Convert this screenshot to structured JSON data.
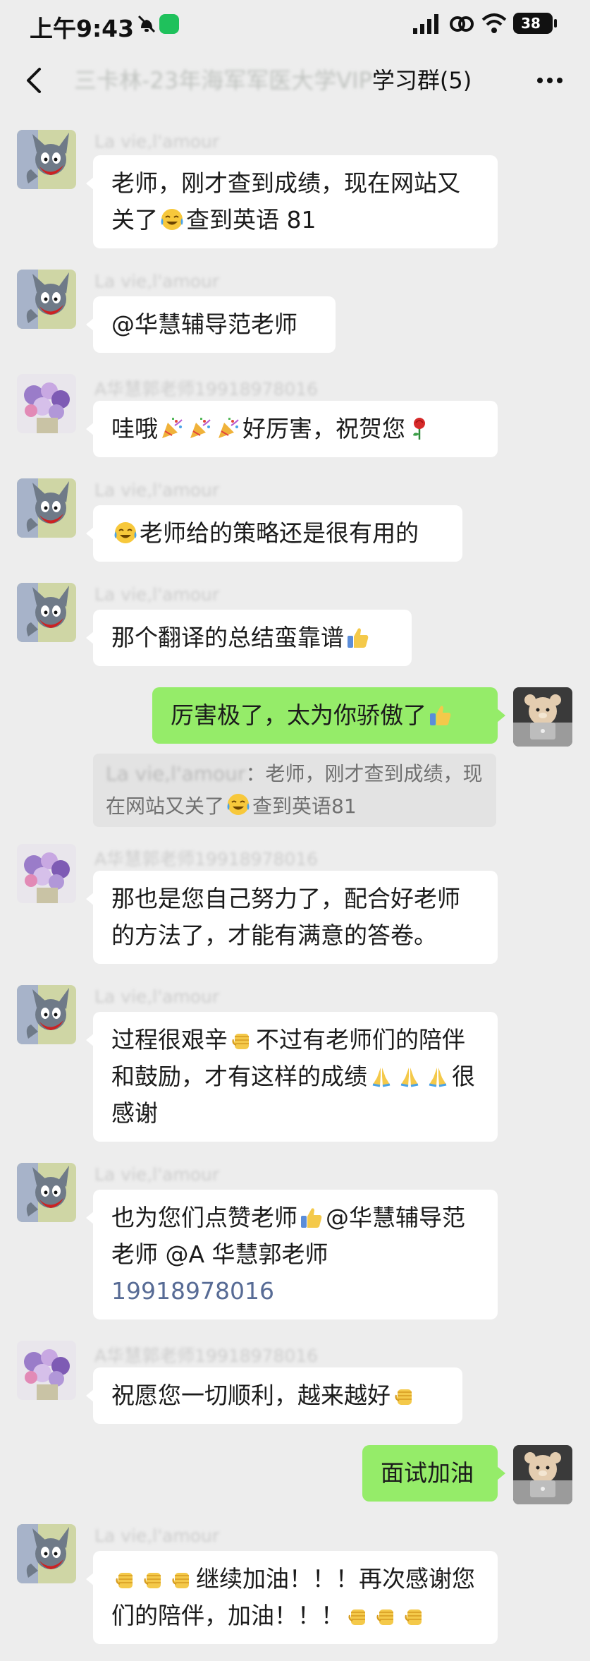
{
  "status_bar": {
    "time": "上午9:43",
    "battery": "38",
    "icons": [
      "mute-icon",
      "app-icon",
      "signal-icon",
      "link-icon",
      "wifi-icon",
      "battery-icon"
    ]
  },
  "header": {
    "title": "三卡林-23年海军军医大学VIP学习群(5)",
    "title_blurred_part": "三卡林-23年海军军医大学VIP",
    "title_clear_part": "学习群(5)"
  },
  "messages": [
    {
      "sender": "La vie,l'amour",
      "text_a": "老师，刚才查到成绩，现在网站又关了",
      "emoji_a": "face-with-tears-emoji",
      "text_b": "查到英语 81"
    },
    {
      "sender": "La vie,l'amour",
      "text": "@华慧辅导范老师"
    },
    {
      "sender": "A华慧郭老师19918978016",
      "text_a": "哇哦",
      "emoji_a": "party-popper-emoji",
      "text_b": "好厉害，祝贺您",
      "emoji_b": "rose-emoji"
    },
    {
      "sender": "La vie,l'amour",
      "emoji_a": "face-with-tears-emoji",
      "text_a": "老师给的策略还是很有用的"
    },
    {
      "sender": "La vie,l'amour",
      "text_a": "那个翻译的总结蛮靠谱",
      "emoji_a": "thumbs-up-emoji"
    },
    {
      "sender": "me",
      "text_a": "厉害极了，太为你骄傲了",
      "emoji_a": "thumbs-up-emoji"
    },
    {
      "sender": "A华慧郭老师19918978016",
      "text": "那也是您自己努力了，配合好老师的方法了，才能有满意的答卷。"
    },
    {
      "sender": "La vie,l'amour",
      "text_a": "过程很艰辛",
      "emoji_a": "fist-emoji",
      "text_b": "不过有老师们的陪伴和鼓励，才有这样的成绩",
      "emoji_b": "folded-hands-emoji",
      "text_c": "很感谢"
    },
    {
      "sender": "La vie,l'amour",
      "text_a": "也为您们点赞老师",
      "emoji_a": "thumbs-up-emoji",
      "text_b": "@华慧辅导范老师 @A 华慧郭老师",
      "number": "19918978016"
    },
    {
      "sender": "A华慧郭老师19918978016",
      "text_a": "祝愿您一切顺利，越来越好",
      "emoji_a": "fist-emoji"
    },
    {
      "sender": "me",
      "text": "面试加油"
    },
    {
      "sender": "La vie,l'amour",
      "emoji_a": "fist-emoji",
      "text_a": "继续加油！！！再次感谢您们的陪伴，加油！！！"
    }
  ],
  "quote": {
    "name": "La vie,l'amour",
    "text_a": "：老师，刚才查到成绩，现在网站又关了",
    "emoji_a": "face-with-tears-emoji",
    "text_b": "查到英语81"
  },
  "colors": {
    "background": "#ededed",
    "bubble_left": "#ffffff",
    "bubble_right": "#95ec69",
    "mention_number": "#576b95"
  }
}
